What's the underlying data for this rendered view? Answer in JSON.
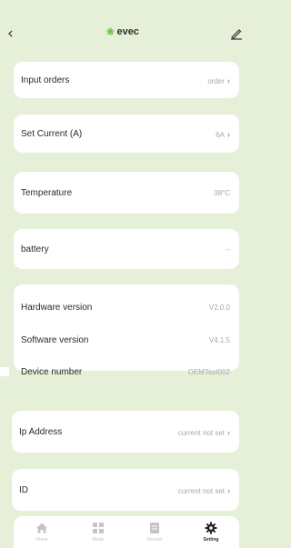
{
  "header": {
    "back_icon": "chevron-left-icon",
    "brand": "evec",
    "edit_icon": "pencil-icon"
  },
  "settings": {
    "input_orders": {
      "label": "Input orders",
      "value": "order"
    },
    "set_current": {
      "label": "Set Current (A)",
      "value": "6A"
    },
    "temperature": {
      "label": "Temperature",
      "value": "38°C"
    },
    "battery": {
      "label": "battery",
      "value": "--"
    }
  },
  "device_info": {
    "hardware": {
      "label": "Hardware version",
      "value": "V2.0.0"
    },
    "software": {
      "label": "Software version",
      "value": "V4.1.5"
    },
    "device_number": {
      "label": "Device number",
      "value": "OEMTest002"
    }
  },
  "network": {
    "ip_address": {
      "label": "Ip Address",
      "value": "current not set"
    },
    "id": {
      "label": "ID",
      "value": "current not set"
    }
  },
  "tabbar": {
    "tabs": [
      {
        "label": "Home",
        "icon": "home-icon"
      },
      {
        "label": "Mode",
        "icon": "grid-icon"
      },
      {
        "label": "Record",
        "icon": "document-icon"
      },
      {
        "label": "Setting",
        "icon": "gear-icon"
      }
    ],
    "active_tab": "Setting"
  },
  "colors": {
    "background": "#e6f0d8",
    "card": "#ffffff",
    "brand_accent": "#6cc04a",
    "muted_text": "#a8a8a8"
  }
}
